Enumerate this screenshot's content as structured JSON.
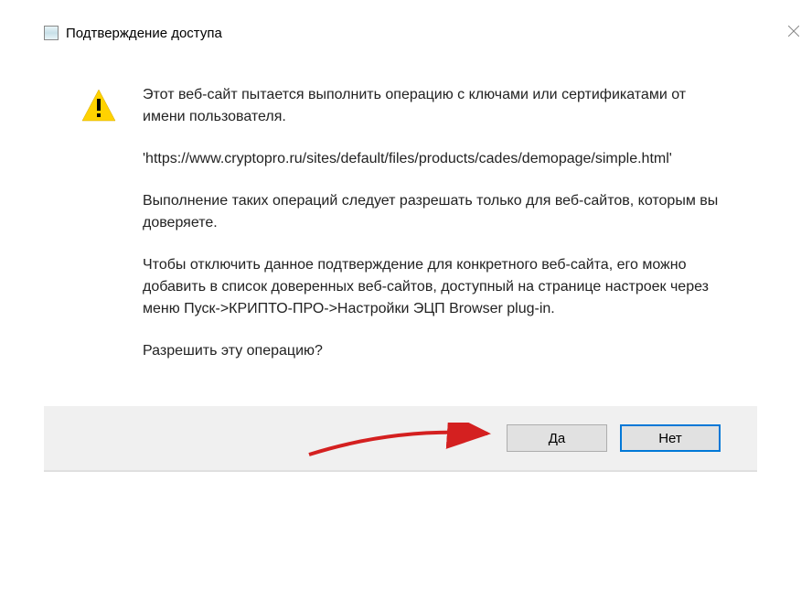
{
  "dialog": {
    "title": "Подтверждение доступа",
    "message_intro": "Этот веб-сайт пытается выполнить операцию с ключами или сертификатами от имени пользователя.",
    "url": "'https://www.cryptopro.ru/sites/default/files/products/cades/demopage/simple.html'",
    "warning_text": "Выполнение таких операций следует разрешать только для веб-сайтов, которым вы доверяете.",
    "instructions": "Чтобы отключить данное подтверждение для конкретного веб-сайта, его можно добавить в список доверенных веб-сайтов, доступный на странице настроек через меню Пуск->КРИПТО-ПРО->Настройки ЭЦП Browser plug-in.",
    "question": "Разрешить эту операцию?",
    "buttons": {
      "yes": "Да",
      "no": "Нет"
    }
  }
}
